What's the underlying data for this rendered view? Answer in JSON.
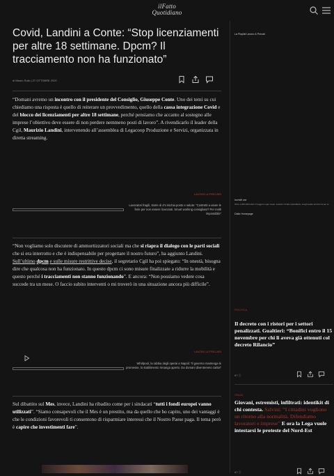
{
  "header": {
    "logo_line1": "ilFatto",
    "logo_line2": "Quotidiano"
  },
  "article": {
    "title": "Covid, Landini a Conte: “Stop licenziamenti per altre 18 settimane. Dpcm? Il tracciamento non ha funzionato”",
    "meta": "di Mauro Sollo | 27 OTTOBRE 2020",
    "p1": [
      {
        "t": "“Domani avremo un "
      },
      {
        "t": "incontro con il presidente del Consiglio, Giuseppe Conte",
        "b": true
      },
      {
        "t": ". Uno dei temi su cui chiediamo una risposta è quello di reiterare un provvedimento, quello della "
      },
      {
        "t": "cassa integrazione Covid",
        "b": true
      },
      {
        "t": " e del "
      },
      {
        "t": "blocco dei licenziamenti per altre 18 settimane",
        "b": true
      },
      {
        "t": ", perché pensiamo che accanto al sostegno alle imprese l’obiettivo deve essere di non perdere nemmeno posti di lavoro”. A rivendicarlo il leader della Cgil, "
      },
      {
        "t": "Maurizio Landini",
        "b": true
      },
      {
        "t": ", intervenendo all’assemblea di Legacoop Produzione e Servizi, organizzata in diretta streaming."
      }
    ],
    "p2": [
      {
        "t": "“Non vogliamo solo discutere di ammortizzatori sociali ma che "
      },
      {
        "t": "si riapra il dialogo con le parti sociali",
        "b": true
      },
      {
        "t": " che si era interrotto e che è indispensabile per progettare il nostro futuro”, ha aggiunto Landini. "
      },
      {
        "t": "Sull’ultimo",
        "u": true
      },
      {
        "t": " "
      },
      {
        "t": "dpcm",
        "u": true,
        "b": true
      },
      {
        "t": " "
      },
      {
        "t": "e sulle misure restrittive decise",
        "u": true
      },
      {
        "t": ", il segretario Cgil ha poi spiegato: “In onestà, bisogna dire che qualcosa non ha funzionato. In questo dpcm ci sono misure finalizzate a ridurre la mobilità e questo perché "
      },
      {
        "t": "i tracciamenti non stanno funzionando",
        "b": true
      },
      {
        "t": "”. E ancora: “Non possiamo vedere cosa succede tra un mese. O faccio subito interventi o mi troverò in una situazione ancora più difficile”."
      }
    ],
    "p3": [
      {
        "t": "Sul dibattito sul "
      },
      {
        "t": "Mes",
        "b": true
      },
      {
        "t": ", invece, Landini ha ribadito come per i sindacati “"
      },
      {
        "t": "tutti i fondi europei vanno utilizzati",
        "b": true
      },
      {
        "t": "”. “Siamo consapevoli che il Mes è un prestito, ma da quello che ho capito, uno dei vantaggi è che le condizioni favorevoli ti consentono di risparmiare interessi che il Nostro Paese paga. Il tema però è "
      },
      {
        "t": "capire che investimenti fare",
        "b": true
      },
      {
        "t": "”."
      }
    ],
    "related1": {
      "label": "LAVORO & PRECARI",
      "text": "Lavoratori fragili, storie di chi rischia posto e salute: “Costretti a usare le ferie per non essere licenziati. Smart working consigliato? Per molti impossibile”"
    },
    "related2": {
      "label": "LAVORO & PRECARI",
      "text": "Whirlpool, la rabbia degli operai a Napoli: “Il governo mantenga le promesse, lo stabilimento rimanga aperto. Da domani diventeremo cattivi”"
    }
  },
  "rail": {
    "playlist_title": "La Playlist Lavoro & Precari",
    "rail_label": "Iscriviti ora",
    "rail_note": "Oltre 1.200.000 lettori ci leggono ogni mese: sostieni il Fatto Quotidiano, scegli quale servizio fa per te",
    "homepage_label": "Dalla Homepage",
    "story1": {
      "tag": "POLITICA",
      "headline": "Il decreto con i ristori per i settori penalizzati. Gualtieri: “Bonifici entro il 15 novembre per chi li aveva già ottenuti col decreto Rilancio”",
      "count": "67 ⓒ"
    },
    "story2": {
      "tag": "ITALIA",
      "headline_a": "Giovani, estremisti, infiltrati: identikit di chi contesta. ",
      "headline_red": "Salvini: “I cittadini vogliono un ritorno alla normalità. Difendiamo lavoratori e imprese”",
      "headline_b": " E ora la Lega vuole intestarsi le proteste del Nord-Est",
      "count": "67 ⓒ"
    }
  },
  "colors": {
    "background": "#141414",
    "text": "#dcdcdc",
    "accent_red": "#c0392b"
  },
  "icons": [
    "search-icon",
    "menu-icon",
    "bookmark-icon",
    "share-icon",
    "comment-icon",
    "play-icon"
  ]
}
